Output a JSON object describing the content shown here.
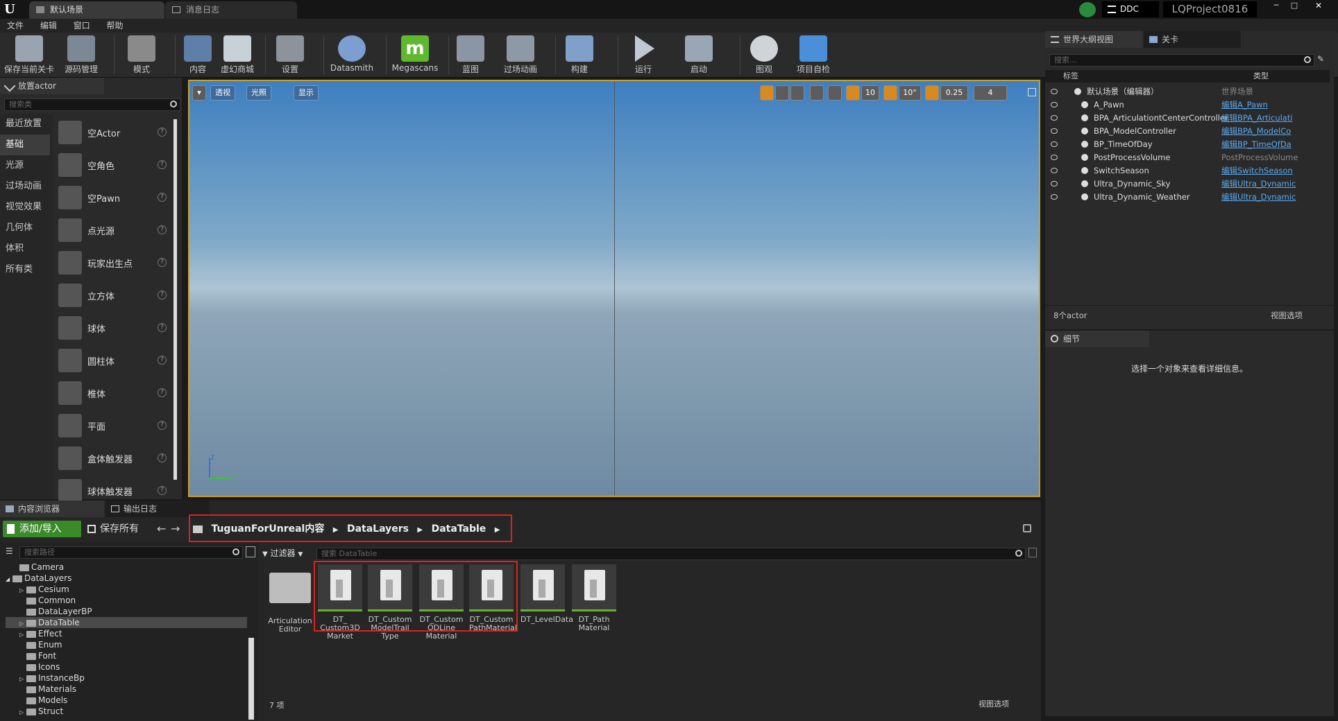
{
  "titlebar": {
    "tabs": [
      "默认场景",
      "消息日志"
    ],
    "ddc": "DDC",
    "project": "LQProject0816",
    "window_controls": [
      "─",
      "□",
      "✕"
    ]
  },
  "menu": [
    "文件",
    "编辑",
    "窗口",
    "帮助"
  ],
  "toolbar": [
    {
      "label": "保存当前关卡",
      "icon": "save-icon"
    },
    {
      "label": "源码管理",
      "icon": "source-control-icon"
    },
    {
      "label": "模式",
      "icon": "modes-icon"
    },
    {
      "label": "内容",
      "icon": "content-icon"
    },
    {
      "label": "虚幻商城",
      "icon": "marketplace-icon"
    },
    {
      "label": "设置",
      "icon": "settings-icon"
    },
    {
      "label": "Datasmith",
      "icon": "datasmith-icon"
    },
    {
      "label": "Megascans",
      "icon": "megascans-icon"
    },
    {
      "label": "蓝图",
      "icon": "blueprint-icon"
    },
    {
      "label": "过场动画",
      "icon": "cinematics-icon"
    },
    {
      "label": "构建",
      "icon": "build-icon"
    },
    {
      "label": "运行",
      "icon": "play-icon"
    },
    {
      "label": "启动",
      "icon": "launch-icon"
    },
    {
      "label": "图观",
      "icon": "tuguan-icon"
    },
    {
      "label": "项目自检",
      "icon": "project-check-icon"
    }
  ],
  "place_panel": {
    "tab": "放置actor",
    "search_placeholder": "搜索类",
    "categories": [
      "最近放置",
      "基础",
      "光源",
      "过场动画",
      "视觉效果",
      "几何体",
      "体积",
      "所有类"
    ],
    "active_category": "基础",
    "items": [
      "空Actor",
      "空角色",
      "空Pawn",
      "点光源",
      "玩家出生点",
      "立方体",
      "球体",
      "圆柱体",
      "椎体",
      "平面",
      "盒体触发器",
      "球体触发器"
    ],
    "help_glyph": "?"
  },
  "viewport": {
    "buttons": [
      "透视",
      "光照",
      "显示"
    ],
    "grid_snap": "10",
    "rotation_snap": "10°",
    "scale_snap": "0.25",
    "camera_speed": "4",
    "axis_z": "Z",
    "axis_y": "Y"
  },
  "outliner": {
    "tab": "世界大纲视图",
    "tab2": "关卡",
    "search_placeholder": "搜索...",
    "col_label": "标签",
    "col_type": "类型",
    "root": {
      "label": "默认场景（编辑器）",
      "type": "世界场景"
    },
    "rows": [
      {
        "label": "A_Pawn",
        "type": "编辑A_Pawn",
        "link": true
      },
      {
        "label": "BPA_ArticulationtCenterController",
        "type": "编辑BPA_Articulati",
        "link": true
      },
      {
        "label": "BPA_ModelController",
        "type": "编辑BPA_ModelCo",
        "link": true
      },
      {
        "label": "BP_TimeOfDay",
        "type": "编辑BP_TimeOfDa",
        "link": true
      },
      {
        "label": "PostProcessVolume",
        "type": "PostProcessVolume",
        "link": false
      },
      {
        "label": "SwitchSeason",
        "type": "编辑SwitchSeason",
        "link": true
      },
      {
        "label": "Ultra_Dynamic_Sky",
        "type": "编辑Ultra_Dynamic",
        "link": true
      },
      {
        "label": "Ultra_Dynamic_Weather",
        "type": "编辑Ultra_Dynamic",
        "link": true
      }
    ],
    "count": "8个actor",
    "view_options": "视图选项"
  },
  "details": {
    "tab": "细节",
    "message": "选择一个对象来查看详细信息。"
  },
  "content_browser": {
    "tab": "内容浏览器",
    "tab2": "输出日志",
    "add_import": "添加/导入",
    "save_all": "保存所有",
    "breadcrumb": [
      "TuguanForUnreal内容",
      "DataLayers",
      "DataTable"
    ],
    "path_search_placeholder": "搜索路径",
    "filter": "过滤器",
    "asset_search_placeholder": "搜索 DataTable",
    "tree": [
      {
        "name": "Camera",
        "indent": 1,
        "expander": ""
      },
      {
        "name": "DataLayers",
        "indent": 0,
        "expander": "◢"
      },
      {
        "name": "Cesium",
        "indent": 2,
        "expander": "▷"
      },
      {
        "name": "Common",
        "indent": 2,
        "expander": ""
      },
      {
        "name": "DataLayerBP",
        "indent": 2,
        "expander": ""
      },
      {
        "name": "DataTable",
        "indent": 2,
        "expander": "▷",
        "selected": true
      },
      {
        "name": "Effect",
        "indent": 2,
        "expander": "▷"
      },
      {
        "name": "Enum",
        "indent": 2,
        "expander": ""
      },
      {
        "name": "Font",
        "indent": 2,
        "expander": ""
      },
      {
        "name": "Icons",
        "indent": 2,
        "expander": ""
      },
      {
        "name": "InstanceBp",
        "indent": 2,
        "expander": "▷"
      },
      {
        "name": "Materials",
        "indent": 2,
        "expander": ""
      },
      {
        "name": "Models",
        "indent": 2,
        "expander": ""
      },
      {
        "name": "Struct",
        "indent": 2,
        "expander": "▷"
      }
    ],
    "assets": [
      {
        "name": "Articulation\nEditor",
        "folder": true
      },
      {
        "name": "DT_\nCustom3D\nMarket"
      },
      {
        "name": "DT_Custom\nModelTrail\nType"
      },
      {
        "name": "DT_Custom\nODLine\nMaterial"
      },
      {
        "name": "DT_Custom\nPathMaterial"
      },
      {
        "name": "DT_LevelData"
      },
      {
        "name": "DT_Path\nMaterial"
      }
    ],
    "item_count": "7 项",
    "view_options": "视图选项"
  },
  "colors": {
    "accent_blue": "#3f6a9a",
    "highlight_red": "#e02020",
    "asset_green": "#67b031",
    "add_button": "#3a8a2a"
  }
}
